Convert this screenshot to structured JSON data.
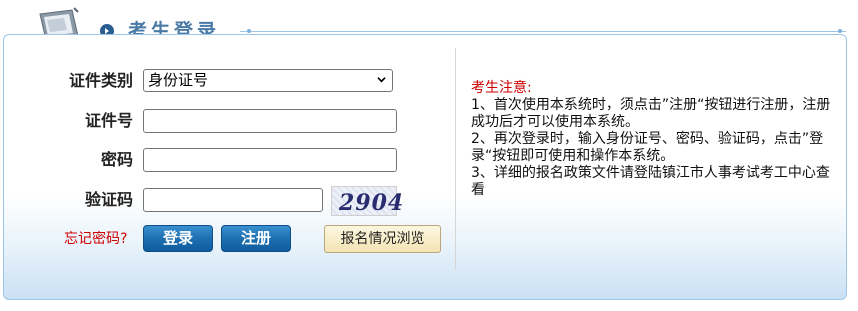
{
  "header": {
    "title": "考生登录"
  },
  "form": {
    "id_type_label": "证件类别",
    "id_type_selected": "身份证号",
    "id_number_label": "证件号",
    "id_number_value": "",
    "password_label": "密码",
    "password_value": "",
    "captcha_label": "验证码",
    "captcha_value": "",
    "captcha_image_text": "2904",
    "forgot_link": "忘记密码?",
    "login_button": "登录",
    "register_button": "注册",
    "browse_button": "报名情况浏览"
  },
  "notice": {
    "title": "考生注意:",
    "items": [
      "1、首次使用本系统时，须点击”注册“按钮进行注册，注册成功后才可以使用本系统。",
      "2、再次登录时，输入身份证号、密码、验证码，点击”登录“按钮即可使用和操作本系统。",
      "3、详细的报名政策文件请登陆镇江市人事考试考工中心查看"
    ]
  },
  "colors": {
    "title": "#4a7aa6",
    "button_blue": "#1d6fb0",
    "notice_title": "#cc0000",
    "forgot_link": "#cc0000"
  },
  "icons": [
    "monitor-icon",
    "bullet-arrow-icon",
    "chevron-down-icon"
  ]
}
